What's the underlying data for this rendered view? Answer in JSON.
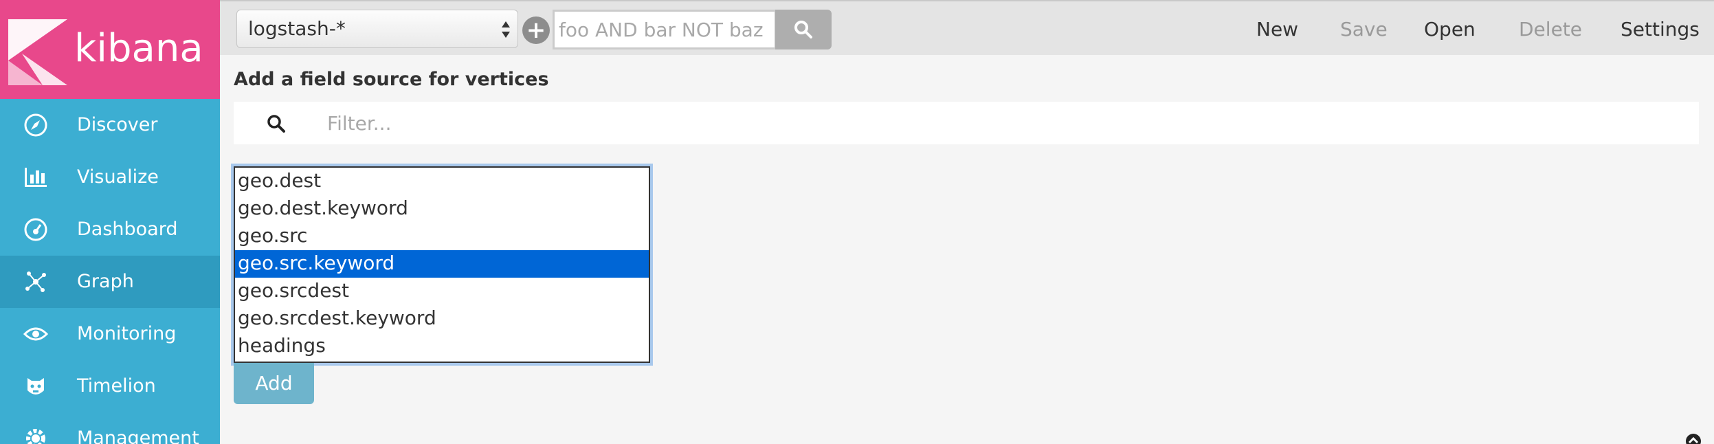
{
  "app": {
    "logo_text": "kibana"
  },
  "sidebar": {
    "items": [
      {
        "label": "Discover",
        "icon": "compass-icon"
      },
      {
        "label": "Visualize",
        "icon": "bar-chart-icon"
      },
      {
        "label": "Dashboard",
        "icon": "gauge-icon"
      },
      {
        "label": "Graph",
        "icon": "graph-network-icon",
        "active": true
      },
      {
        "label": "Monitoring",
        "icon": "eye-icon"
      },
      {
        "label": "Timelion",
        "icon": "timelion-icon"
      },
      {
        "label": "Management",
        "icon": "gear-icon"
      }
    ]
  },
  "topbar": {
    "index_pattern": "logstash-*",
    "search_placeholder": "foo AND bar NOT baz",
    "menu": {
      "new": "New",
      "save": "Save",
      "open": "Open",
      "delete": "Delete",
      "settings": "Settings"
    }
  },
  "main": {
    "title": "Add a field source for vertices",
    "filter_placeholder": "Filter...",
    "fields": [
      "geo.dest",
      "geo.dest.keyword",
      "geo.src",
      "geo.src.keyword",
      "geo.srcdest",
      "geo.srcdest.keyword",
      "headings"
    ],
    "selected_field": "geo.src.keyword",
    "add_label": "Add"
  },
  "colors": {
    "sidebar": "#3caed2",
    "sidebar_active": "#2f9bbf",
    "logo_bg": "#e8488b",
    "selected_row": "#0066d6",
    "add_button": "#6eb4cc"
  }
}
